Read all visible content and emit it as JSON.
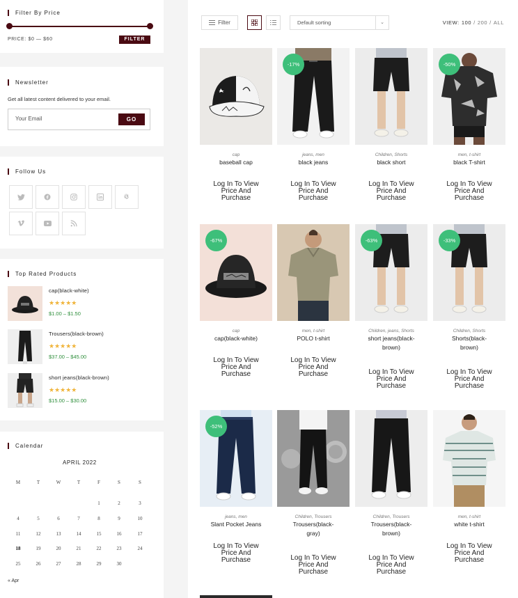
{
  "sidebar": {
    "filter_price": {
      "title": "Filter By Price",
      "price_label": "PRICE: $0 — $60",
      "filter_button": "FILTER"
    },
    "newsletter": {
      "title": "Newsletter",
      "description": "Get all latest content delivered to your email.",
      "email_placeholder": "Your Email",
      "go_button": "GO"
    },
    "follow_us": {
      "title": "Follow Us",
      "icons": [
        "twitter-icon",
        "facebook-icon",
        "instagram-icon",
        "linkedin-icon",
        "pinterest-icon",
        "vimeo-icon",
        "youtube-icon",
        "rss-icon"
      ]
    },
    "top_rated": {
      "title": "Top Rated Products",
      "items": [
        {
          "name": "cap(black-white)",
          "stars": "★★★★★",
          "price": "$1.00 – $1.50"
        },
        {
          "name": "Trousers(black-brown)",
          "stars": "★★★★★",
          "price": "$37.00 – $45.00"
        },
        {
          "name": "short jeans(black-brown)",
          "stars": "★★★★★",
          "price": "$15.00 – $30.00"
        }
      ]
    },
    "calendar": {
      "title": "Calendar",
      "caption": "APRIL 2022",
      "weekdays": [
        "M",
        "T",
        "W",
        "T",
        "F",
        "S",
        "S"
      ],
      "weeks": [
        [
          "",
          "",
          "",
          "",
          "1",
          "2",
          "3"
        ],
        [
          "4",
          "5",
          "6",
          "7",
          "8",
          "9",
          "10"
        ],
        [
          "11",
          "12",
          "13",
          "14",
          "15",
          "16",
          "17"
        ],
        [
          "18",
          "19",
          "20",
          "21",
          "22",
          "23",
          "24"
        ],
        [
          "25",
          "26",
          "27",
          "28",
          "29",
          "30",
          ""
        ]
      ],
      "today": "18",
      "prev_link": "« Apr"
    }
  },
  "toolbar": {
    "filter_label": "Filter",
    "sort_value": "Default sorting",
    "view_label": "VIEW:",
    "view_100": "100",
    "view_200": "200",
    "view_all": "ALL",
    "sep1": "/",
    "sep2": "/"
  },
  "products": [
    {
      "category": "cap",
      "name": "baseball cap",
      "badge": "",
      "cta": "Log In To View Price And Purchase",
      "img": "cap-white"
    },
    {
      "category": "jeans, men",
      "name": "black jeans",
      "badge": "-17%",
      "cta": "Log In To View Price And Purchase",
      "img": "pants"
    },
    {
      "category": "Children, Shorts",
      "name": "black short",
      "badge": "",
      "cta": "Log In To View Price And Purchase",
      "img": "shorts"
    },
    {
      "category": "men, t-shirt",
      "name": "black T-shirt",
      "badge": "-50%",
      "cta": "Log In To View Price And Purchase",
      "img": "tshirt-dark"
    },
    {
      "category": "cap",
      "name": "cap(black-white)",
      "badge": "-67%",
      "cta": "Log In To View Price And Purchase",
      "img": "bucket-hat"
    },
    {
      "category": "men, t-shirt",
      "name": "POLO t-shirt",
      "badge": "",
      "cta": "Log In To View Price And Purchase",
      "img": "polo"
    },
    {
      "category": "Children, jeans, Shorts",
      "name": "short jeans(black-brown)",
      "badge": "-63%",
      "cta": "Log In To View Price And Purchase",
      "img": "shorts"
    },
    {
      "category": "Children, Shorts",
      "name": "Shorts(black-brown)",
      "badge": "-33%",
      "cta": "Log In To View Price And Purchase",
      "img": "shorts"
    },
    {
      "category": "jeans, men",
      "name": "Slant Pocket Jeans",
      "badge": "-52%",
      "cta": "Log In To View Price And Purchase",
      "img": "jeans"
    },
    {
      "category": "Children, Trousers",
      "name": "Trousers(black-gray)",
      "badge": "",
      "cta": "Log In To View Price And Purchase",
      "img": "trousers-gray"
    },
    {
      "category": "Children, Trousers",
      "name": "Trousers(black-brown)",
      "badge": "",
      "cta": "Log In To View Price And Purchase",
      "img": "trousers"
    },
    {
      "category": "men, t-shirt",
      "name": "white t-shirt",
      "badge": "",
      "cta": "Log In To View Price And Purchase",
      "img": "striped-tee"
    }
  ],
  "colors": {
    "accent": "#4a0a12",
    "badge": "#3ebf7a",
    "price": "#2f8f3c",
    "stars": "#f0b43a"
  }
}
